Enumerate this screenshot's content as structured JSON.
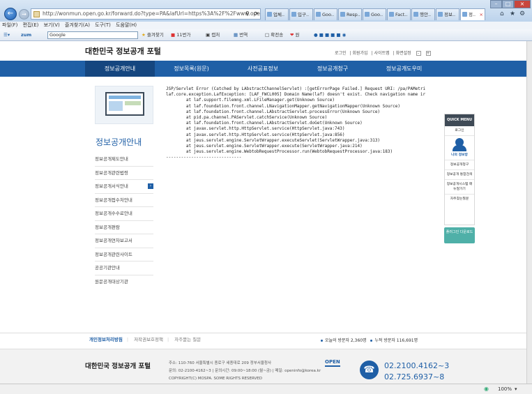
{
  "browser": {
    "url": "http://wonmun.open.go.kr/forward.do?type=PA&lafUrl=https%3A%2F%2Fwww.open.go.kr%2Fp",
    "tabs": [
      "업체..",
      "입구..",
      "Goo..",
      "Resp..",
      "Goo..",
      "Fact..",
      "행안..",
      "정보..",
      "정.."
    ],
    "menu": [
      "파일(F)",
      "편집(E)",
      "보기(V)",
      "즐겨찾기(A)",
      "도구(T)",
      "도움말(H)"
    ],
    "toolbar": {
      "zum": "zum",
      "search_placeholder": "Google",
      "fav": "즐겨찾기",
      "eleven": "11번가",
      "capture": "캡처",
      "translate": "번역",
      "zoom_view": "확전송",
      "one": "원"
    },
    "status_zoom": "100%"
  },
  "site": {
    "logo": "대한민국 정보공개 포털",
    "util_links": [
      "로그인",
      "회원가입",
      "사이트맵",
      "화면설정"
    ],
    "gnb": [
      "정보공개안내",
      "정보목록(원문)",
      "사전공표정보",
      "정보공개청구",
      "정보공개도우미"
    ],
    "lnb_title": "정보공개안내",
    "lnb_items": [
      "정보공개제도안내",
      "정보공개관련법령",
      "정보공개서식안내",
      "정보공개접수처안내",
      "정보공개수수료안내",
      "정보공개편람",
      "정보공개연차보고서",
      "정보공개관련사이트",
      "공공기관안내",
      "원문공개대상기관"
    ],
    "error_lines": [
      "JSP/Servlet Error (Catched by LAbstractChannelServlet) :[getErrorPage Failed.] Request URI: /pa/PAMetri",
      "laf.core.exception.LafException: [LAF_FWCL005] Domain Name(laf) doesn't exist. Check navigation name ir",
      "        at laf.support.filemng.xml.LFileManager.get(Unknown Source)",
      "        at laf.foundation.front.channel.LNavigationMapper.getNavigationMapper(Unknown Source)",
      "        at laf.foundation.front.channel.LAbstractServlet.processError(Unknown Source)",
      "        at pid.pa.channel.PAServlet.catchService(Unknown Source)",
      "        at laf.foundation.front.channel.LAbstractServlet.doGet(Unknown Source)",
      "        at javax.servlet.http.HttpServlet.service(HttpServlet.java:743)",
      "        at javax.servlet.http.HttpServlet.service(HttpServlet.java:856)",
      "        at jeus.servlet.engine.ServletWrapper.executeServlet(ServletWrapper.java:313)",
      "        at jeus.servlet.engine.ServletWrapper.execute(ServletWrapper.java:214)",
      "        at jeus.servlet.engine.WebtobRequestProcessor.run(WebtobRequestProcessor.java:183)",
      "------------------------------"
    ],
    "quick": {
      "title": "QUICK MENU",
      "items": [
        "로그인",
        "나의 정보방",
        "정보공개청구",
        "정보공개 통합검색",
        "정보공개시스템 매뉴얼가기",
        "자주찾는질문"
      ],
      "button": "플러그인 다운로드"
    },
    "footer": {
      "links": [
        "개인정보처리방침",
        "저작권보호정책",
        "자주묻는 질문"
      ],
      "visitors": "오늘의 방문자 2,360명",
      "total": "누적 방문자 116,691명",
      "logo": "대한민국 정보공개 포털",
      "address": "주소: 110-760 서울특별시 종로구 세종대로 209 정부서울청사",
      "contact": "문의: 02-2100-4162~3 | 문의시간: 09:00~18:00 (월~금) | 메일: openinfo@korea.kr",
      "copyright": "COPYRIGHT(C) MOSPA. SOME RIGHTS RESERVED",
      "open_logo": "OPEN",
      "phone1": "02.2100.4162~3",
      "phone2": "02.725.6937~8"
    }
  }
}
